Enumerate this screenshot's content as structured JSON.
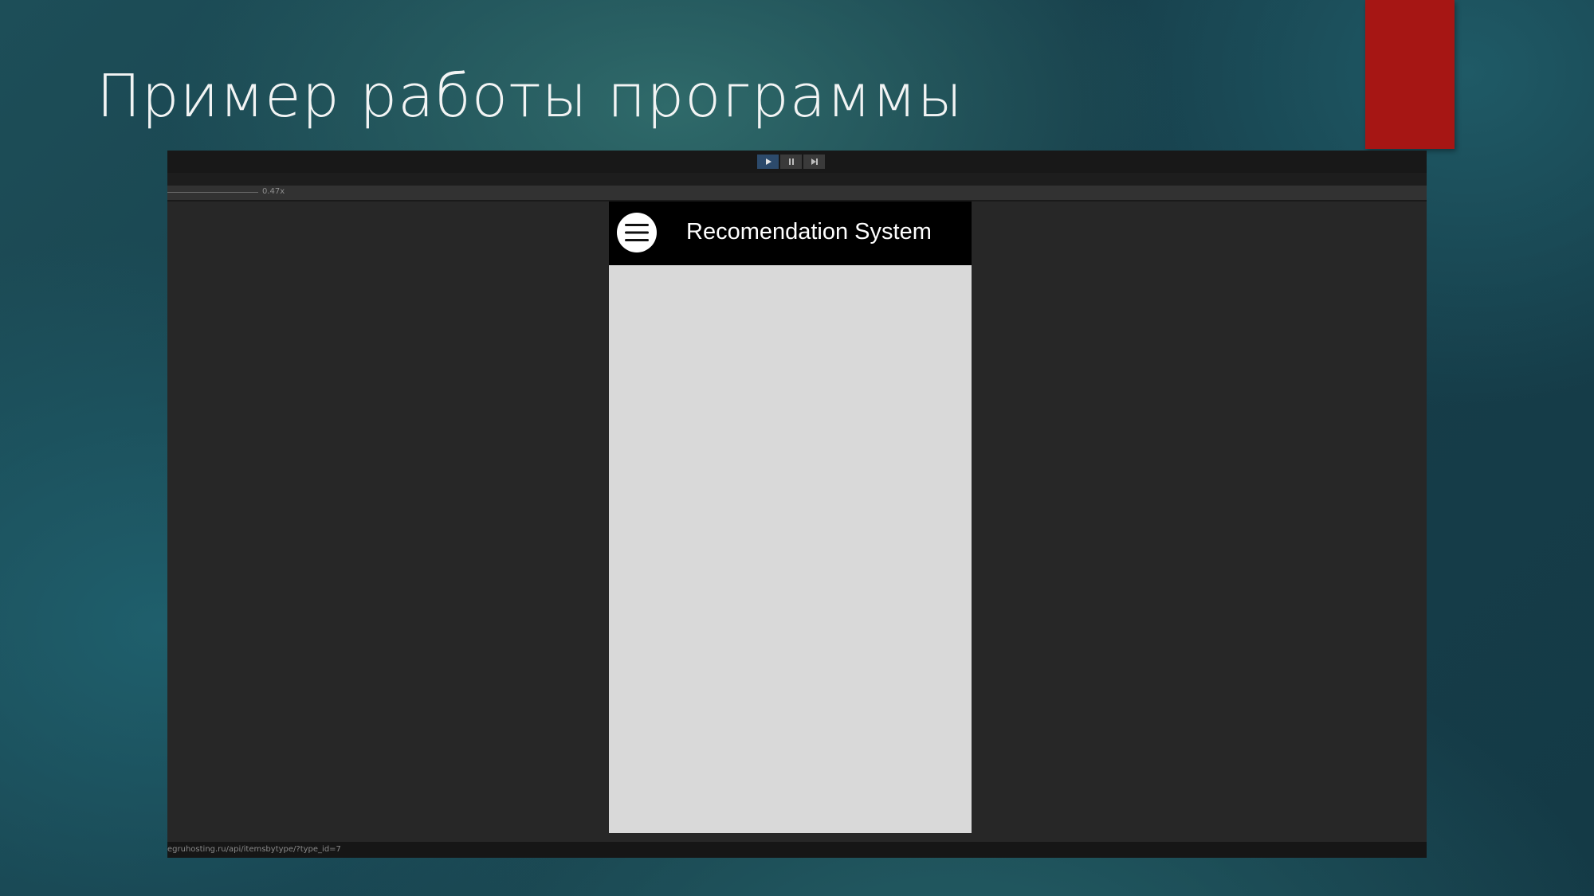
{
  "slide": {
    "title": "Пример работы программы",
    "accent_color": "#a61614"
  },
  "window": {
    "transport": {
      "play_icon": "play-icon",
      "pause_icon": "pause-icon",
      "step_icon": "step-forward-icon"
    },
    "zoom_label": "0.47x",
    "status_url": "egruhosting.ru/api/itemsbytype/?type_id=7"
  },
  "app": {
    "title": "Recomendation System",
    "menu_icon": "hamburger-menu-icon",
    "header_color": "#000000",
    "body_color": "#d9d9d9"
  }
}
